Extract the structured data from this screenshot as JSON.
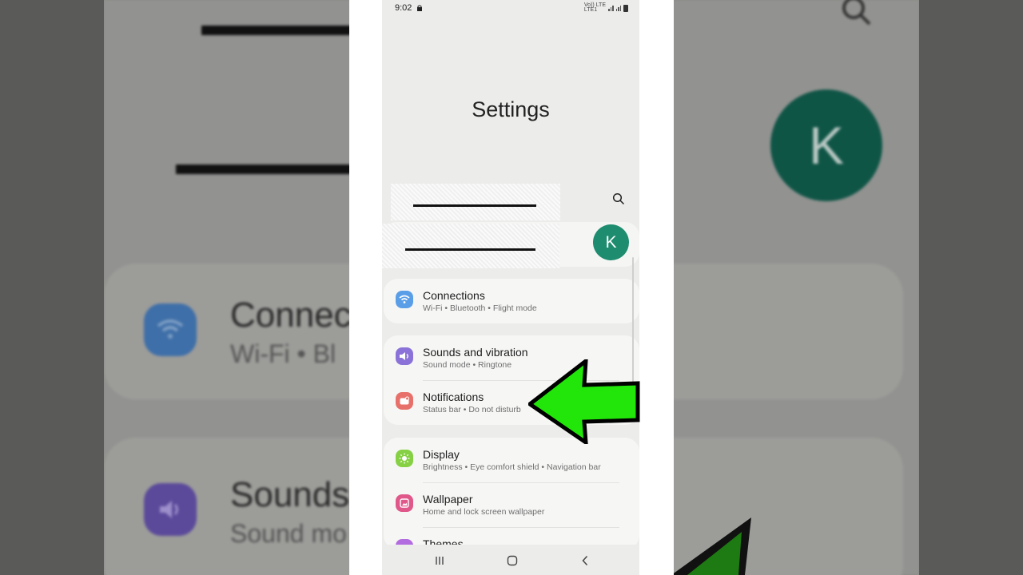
{
  "status_bar": {
    "time": "9:02",
    "network_label_top": "Vo)) LTE",
    "network_label_bottom": "LTE1"
  },
  "page_title": "Settings",
  "profile": {
    "avatar_letter": "K",
    "avatar_color": "#1e8c6f"
  },
  "settings": {
    "connections": {
      "title": "Connections",
      "subtitle": "Wi-Fi  •  Bluetooth  •  Flight mode",
      "icon": "wifi-icon",
      "color": "#5b9ee8"
    },
    "sounds": {
      "title": "Sounds and vibration",
      "subtitle": "Sound mode  •  Ringtone",
      "icon": "speaker-icon",
      "color": "#8a72d8"
    },
    "notifications": {
      "title": "Notifications",
      "subtitle": "Status bar  •  Do not disturb",
      "icon": "notification-icon",
      "color": "#e7716a"
    },
    "display": {
      "title": "Display",
      "subtitle": "Brightness  •  Eye comfort shield  •  Navigation bar",
      "icon": "sun-icon",
      "color": "#86d044"
    },
    "wallpaper": {
      "title": "Wallpaper",
      "subtitle": "Home and lock screen wallpaper",
      "icon": "image-icon",
      "color": "#e0578a"
    },
    "themes": {
      "title": "Themes",
      "icon": "themes-icon",
      "color": "#b36be0"
    }
  },
  "backdrop": {
    "connections_text": "Connect",
    "connections_sub": "Wi-Fi  •  Bl",
    "sounds_text": "Sounds",
    "sounds_sub": "Sound mo",
    "avatar_letter": "K"
  },
  "overlay": {
    "arrow_color": "#22e60a"
  }
}
